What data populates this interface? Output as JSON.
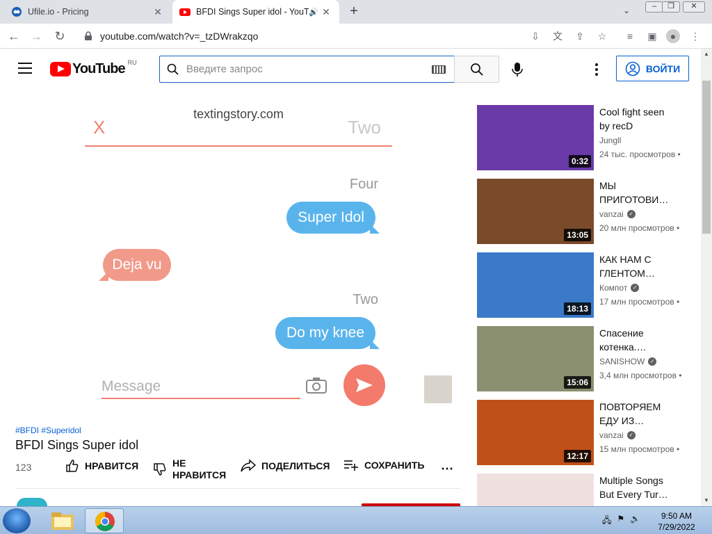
{
  "browser": {
    "tabs": [
      {
        "title": "Ufile.io - Pricing",
        "active": false
      },
      {
        "title": "BFDI Sings Super idol - YouT",
        "active": true
      }
    ],
    "url": "youtube.com/watch?v=_tzDWrakzqo"
  },
  "youtube": {
    "logo_text": "YouTube",
    "region": "RU",
    "search_placeholder": "Введите запрос",
    "signin_label": "ВОЙТИ"
  },
  "video": {
    "frame": {
      "site": "textingstory.com",
      "x_label": "X",
      "contact": "Two",
      "messages": [
        {
          "sender": "Four",
          "text": "Super Idol",
          "side": "right"
        },
        {
          "sender": "",
          "text": "Deja vu",
          "side": "left"
        },
        {
          "sender": "Two",
          "text": "Do my knee",
          "side": "right"
        }
      ],
      "message_placeholder": "Message"
    },
    "tags": "#BFDI #Superidol",
    "title": "BFDI Sings Super idol",
    "views": "123",
    "actions": {
      "like": "НРАВИТСЯ",
      "dislike": "НЕ НРАВИТСЯ",
      "share": "ПОДЕЛИТЬСЯ",
      "save": "СОХРАНИТЬ"
    }
  },
  "recommendations": [
    {
      "title": "Cool fight seen by recD",
      "channel": "Jungll",
      "verified": false,
      "meta": "24 тыс. просмотров •",
      "duration": "0:32",
      "thumb_color": "#6a3aa8"
    },
    {
      "title": "МЫ ПРИГОТОВИ…",
      "channel": "vanzai",
      "verified": true,
      "meta": "20 млн просмотров •",
      "duration": "13:05",
      "thumb_color": "#7a4a2a"
    },
    {
      "title": "КАК НАМ С ГЛЕНТОМ…",
      "channel": "Компот",
      "verified": true,
      "meta": "17 млн просмотров •",
      "duration": "18:13",
      "thumb_color": "#3a7ac8"
    },
    {
      "title": "Спасение котенка.…",
      "channel": "SANISHOW",
      "verified": true,
      "meta": "3,4 млн просмотров •",
      "duration": "15:06",
      "thumb_color": "#8a9070"
    },
    {
      "title": "ПОВТОРЯЕМ ЕДУ ИЗ…",
      "channel": "vanzai",
      "verified": true,
      "meta": "15 млн просмотров •",
      "duration": "12:17",
      "thumb_color": "#c0501a"
    },
    {
      "title": "Multiple Songs But Every Tur…",
      "channel": "",
      "verified": false,
      "meta": "",
      "duration": "",
      "thumb_color": "#f0e0e0"
    }
  ],
  "taskbar": {
    "time": "9:50 AM",
    "date": "7/29/2022"
  }
}
